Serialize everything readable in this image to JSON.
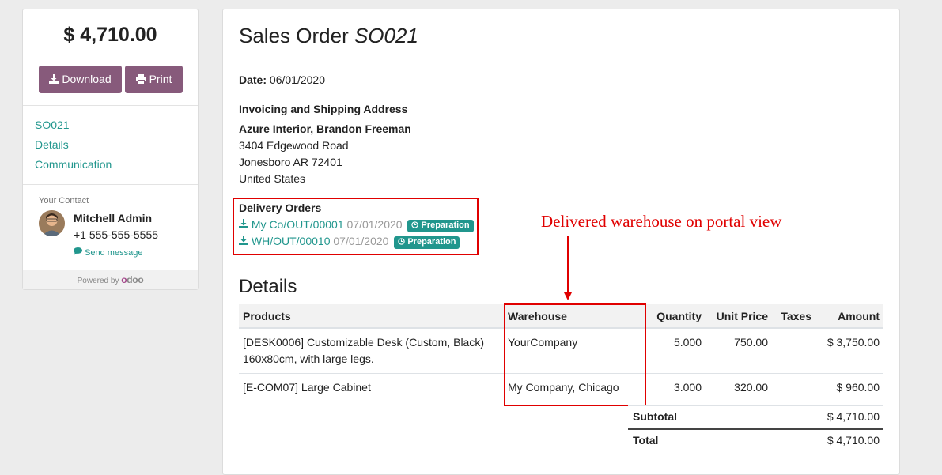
{
  "sidebar": {
    "total": "$ 4,710.00",
    "download_label": "Download",
    "print_label": "Print",
    "nav": [
      "SO021",
      "Details",
      "Communication"
    ],
    "contact_label": "Your Contact",
    "contact_name": "Mitchell Admin",
    "contact_phone": "+1 555-555-5555",
    "send_message": "Send message",
    "powered_by": "Powered by",
    "powered_logo": "odoo"
  },
  "order": {
    "title_prefix": "Sales Order",
    "title_ref": "SO021",
    "date_label": "Date:",
    "date_value": "06/01/2020",
    "address_heading": "Invoicing and Shipping Address",
    "customer": "Azure Interior, Brandon Freeman",
    "address_lines": [
      "3404 Edgewood Road",
      "Jonesboro AR 72401",
      "United States"
    ],
    "delivery_heading": "Delivery Orders",
    "deliveries": [
      {
        "ref": "My Co/OUT/00001",
        "date": "07/01/2020",
        "status": "Preparation"
      },
      {
        "ref": "WH/OUT/00010",
        "date": "07/01/2020",
        "status": "Preparation"
      }
    ],
    "annotation": "Delivered warehouse on portal view",
    "details_heading": "Details",
    "columns": [
      "Products",
      "Warehouse",
      "Quantity",
      "Unit Price",
      "Taxes",
      "Amount"
    ],
    "lines": [
      {
        "product": "[DESK0006] Customizable Desk (Custom, Black) 160x80cm, with large legs.",
        "warehouse": "YourCompany",
        "qty": "5.000",
        "price": "750.00",
        "taxes": "",
        "amount": "$ 3,750.00"
      },
      {
        "product": "[E-COM07] Large Cabinet",
        "warehouse": "My Company, Chicago",
        "qty": "3.000",
        "price": "320.00",
        "taxes": "",
        "amount": "$ 960.00"
      }
    ],
    "subtotal_label": "Subtotal",
    "subtotal_value": "$ 4,710.00",
    "total_label": "Total",
    "total_value": "$ 4,710.00"
  },
  "colors": {
    "brand": "#875a7b",
    "link": "#21968d",
    "annotation": "#e00000"
  },
  "icons": [
    "download-icon",
    "print-icon",
    "chat-icon",
    "clock-icon"
  ]
}
